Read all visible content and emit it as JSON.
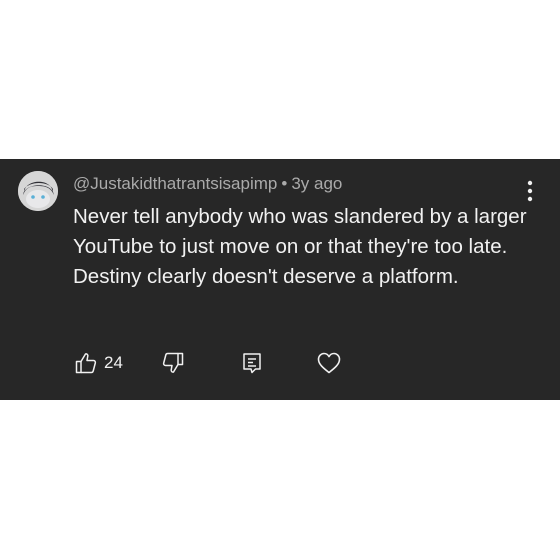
{
  "comment": {
    "author": "@Justakidthatrantsisapimp",
    "separator": "•",
    "time": "3y ago",
    "text": "Never tell anybody who was slandered by a larger YouTube to just move on or that they're too late. Destiny clearly doesn't deserve a platform.",
    "like_count": "24"
  },
  "icons": {
    "more": "more-vertical-icon",
    "like": "thumbs-up-icon",
    "dislike": "thumbs-down-icon",
    "reply": "reply-comment-icon",
    "heart": "heart-icon"
  },
  "colors": {
    "card_background": "#272727",
    "text_primary": "#f1f1f1",
    "text_secondary": "#aaaaaa"
  }
}
